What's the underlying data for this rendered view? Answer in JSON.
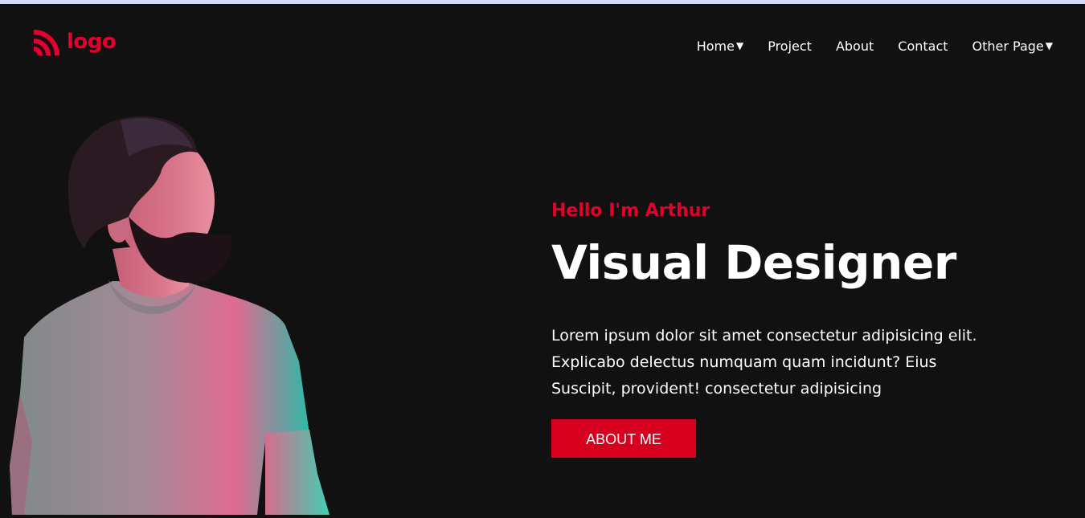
{
  "brand": {
    "logo_text": "logo",
    "accent_color": "#e4002b",
    "logo_icon": "rss-feed-icon"
  },
  "nav": {
    "items": [
      {
        "label": "Home",
        "has_dropdown": true
      },
      {
        "label": "Project",
        "has_dropdown": false
      },
      {
        "label": "About",
        "has_dropdown": false
      },
      {
        "label": "Contact",
        "has_dropdown": false
      },
      {
        "label": "Other Page",
        "has_dropdown": true
      }
    ],
    "dropdown_glyph": "▼"
  },
  "hero": {
    "greeting": "Hello I'm Arthur",
    "title": "Visual Designer",
    "description_lines": [
      "Lorem ipsum dolor sit amet consectetur adipisicing elit.",
      "Explicabo delectus numquam quam incidunt? Eius",
      "Suscipit, provident! consectetur adipisicing"
    ],
    "cta_label": "ABOUT ME",
    "cta_color": "#d7001f"
  },
  "colors": {
    "background": "#111111",
    "top_strip": "#d5daf7",
    "text": "#ffffff"
  }
}
